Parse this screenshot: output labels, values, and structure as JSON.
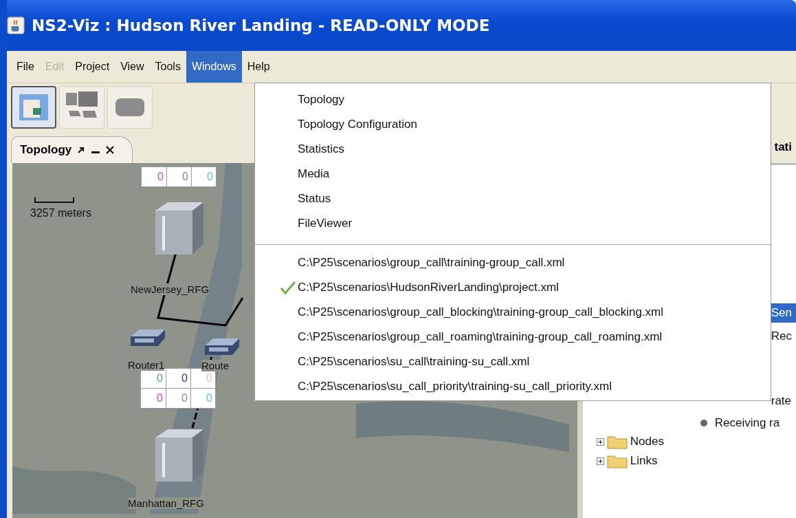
{
  "window": {
    "title": "NS2-Viz : Hudson River Landing - READ-ONLY MODE"
  },
  "menu_bar": [
    {
      "label": "File",
      "disabled": false,
      "selected": false
    },
    {
      "label": "Edit",
      "disabled": true,
      "selected": false
    },
    {
      "label": "Project",
      "disabled": false,
      "selected": false
    },
    {
      "label": "View",
      "disabled": false,
      "selected": false
    },
    {
      "label": "Tools",
      "disabled": false,
      "selected": false
    },
    {
      "label": "Windows",
      "disabled": false,
      "selected": true
    },
    {
      "label": "Help",
      "disabled": false,
      "selected": false
    }
  ],
  "toolbar": [
    {
      "kind": "topology",
      "selected": true
    },
    {
      "kind": "network",
      "selected": false
    },
    {
      "kind": "media",
      "selected": false
    }
  ],
  "topology_tab": {
    "label": "Topology"
  },
  "map": {
    "scale": "3257 meters",
    "nodes": [
      {
        "kind": "server",
        "label": "NewJersey_RFG"
      },
      {
        "kind": "router",
        "label": "Router1"
      },
      {
        "kind": "router",
        "label": "Route"
      },
      {
        "kind": "server",
        "label": "Manhattan_RFG"
      }
    ],
    "counters": [
      [
        [
          {
            "value": "0",
            "color": "#cc44cc"
          },
          {
            "value": "0",
            "color": "#888888"
          },
          {
            "value": "0",
            "color": "#55c8d8"
          }
        ]
      ],
      [
        [
          {
            "value": "0",
            "color": "#55aa55"
          },
          {
            "value": "0",
            "color": "#303078"
          },
          {
            "value": "0",
            "color": "#f0b8b8"
          }
        ],
        [
          {
            "value": "0",
            "color": "#cc44cc"
          },
          {
            "value": "0",
            "color": "#888888"
          },
          {
            "value": "0",
            "color": "#55c8d8"
          }
        ]
      ]
    ]
  },
  "statistics_panel": {
    "tab": "tati",
    "tree": [
      {
        "kind": "cut",
        "label": "Sen",
        "selected": true
      },
      {
        "kind": "cut",
        "label": "Rec",
        "selected": false
      },
      {
        "kind": "cut",
        "label": "rate",
        "selected": false
      },
      {
        "kind": "leaf",
        "label": "Receiving ra",
        "selected": false
      },
      {
        "kind": "folder",
        "label": "Nodes",
        "selected": false,
        "expanded": false
      },
      {
        "kind": "folder",
        "label": "Links",
        "selected": false,
        "expanded": false
      }
    ]
  },
  "windows_menu": [
    [
      {
        "label": "Topology",
        "checked": false
      },
      {
        "label": "Topology Configuration",
        "checked": false
      },
      {
        "label": "Statistics",
        "checked": false
      },
      {
        "label": "Media",
        "checked": false
      },
      {
        "label": "Status",
        "checked": false
      },
      {
        "label": "FileViewer",
        "checked": false
      }
    ],
    [
      {
        "label": "C:\\P25\\scenarios\\group_call\\training-group_call.xml",
        "checked": false
      },
      {
        "label": "C:\\P25\\scenarios\\HudsonRiverLanding\\project.xml",
        "checked": true
      },
      {
        "label": "C:\\P25\\scenarios\\group_call_blocking\\training-group_call_blocking.xml",
        "checked": false
      },
      {
        "label": "C:\\P25\\scenarios\\group_call_roaming\\training-group_call_roaming.xml",
        "checked": false
      },
      {
        "label": "C:\\P25\\scenarios\\su_call\\training-su_call.xml",
        "checked": false
      },
      {
        "label": "C:\\P25\\scenarios\\su_call_priority\\training-su_call_priority.xml",
        "checked": false
      }
    ]
  ]
}
